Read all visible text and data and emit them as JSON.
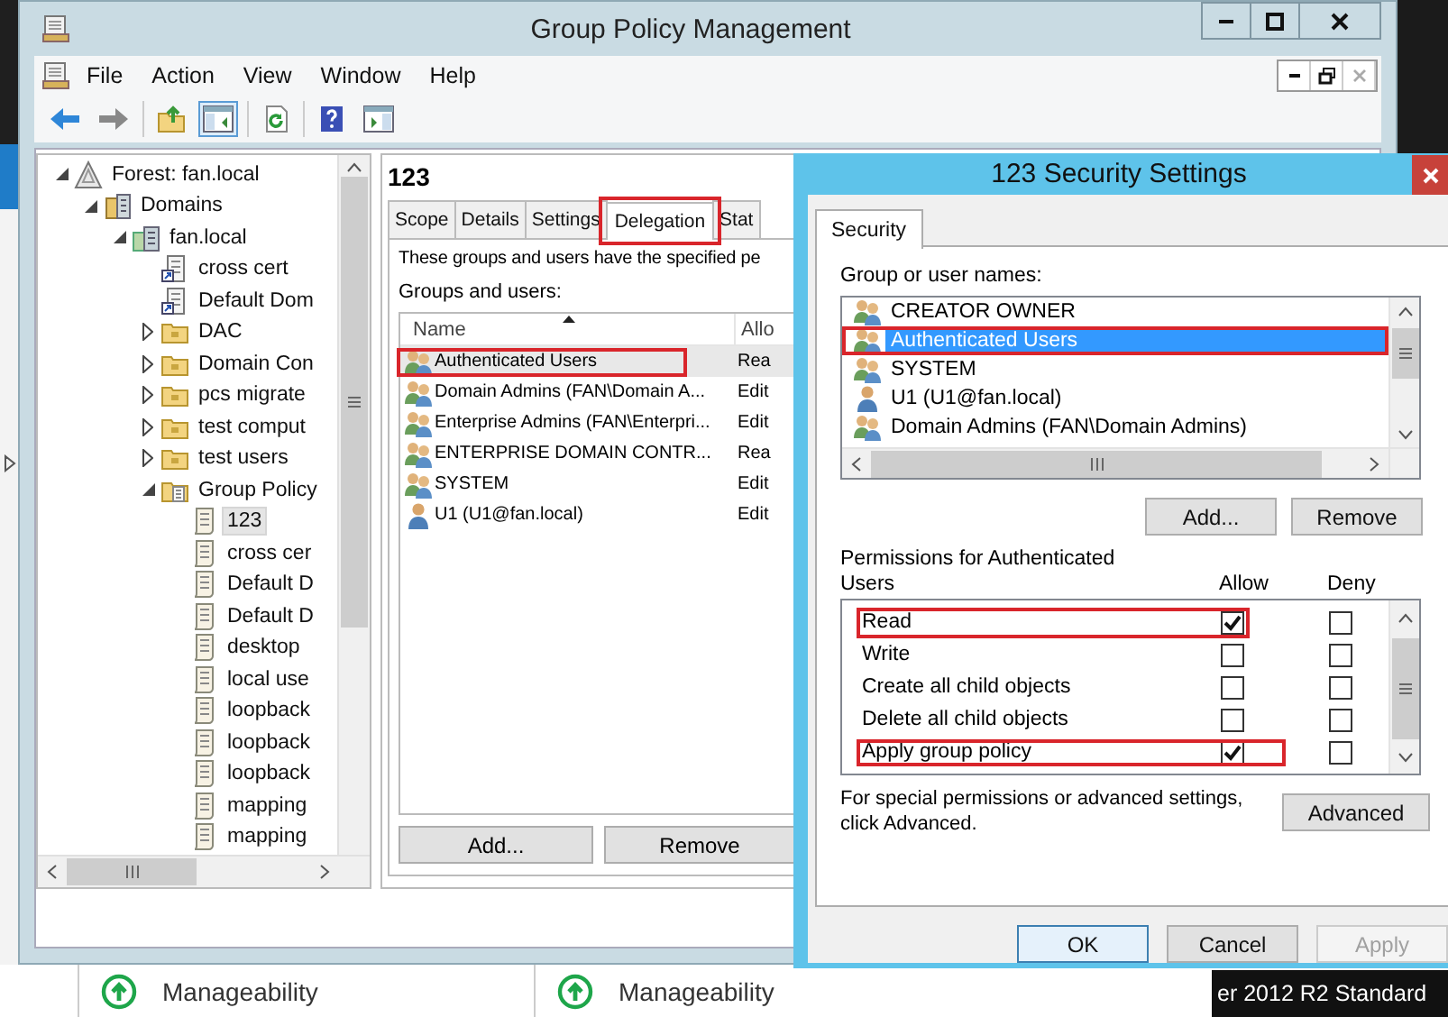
{
  "desktop": {
    "tiles": [
      {
        "label": "Manageability"
      },
      {
        "label": "Manageability"
      }
    ],
    "edition_text": "er 2012 R2 Standard"
  },
  "window": {
    "title": "Group Policy Management"
  },
  "menu": [
    "File",
    "Action",
    "View",
    "Window",
    "Help"
  ],
  "tree": [
    {
      "label": "Forest: fan.local",
      "kind": "forest",
      "expanded": true,
      "selected": false,
      "children": [
        {
          "label": "Domains",
          "kind": "domains",
          "expanded": true,
          "selected": false,
          "children": [
            {
              "label": "fan.local",
              "kind": "domain",
              "expanded": true,
              "selected": false,
              "children": [
                {
                  "label": "cross cert",
                  "kind": "link",
                  "selected": false
                },
                {
                  "label": "Default Dom",
                  "kind": "link",
                  "selected": false
                },
                {
                  "label": "DAC",
                  "kind": "ou",
                  "expanded": false,
                  "selected": false
                },
                {
                  "label": "Domain Con",
                  "kind": "ou",
                  "expanded": false,
                  "selected": false
                },
                {
                  "label": "pcs migrate",
                  "kind": "ou",
                  "expanded": false,
                  "selected": false
                },
                {
                  "label": "test comput",
                  "kind": "ou",
                  "expanded": false,
                  "selected": false
                },
                {
                  "label": "test users",
                  "kind": "ou",
                  "expanded": false,
                  "selected": false
                },
                {
                  "label": "Group Policy",
                  "kind": "container",
                  "expanded": true,
                  "selected": false,
                  "children": [
                    {
                      "label": "123",
                      "kind": "gpo",
                      "selected": true
                    },
                    {
                      "label": "cross cer",
                      "kind": "gpo",
                      "selected": false
                    },
                    {
                      "label": "Default D",
                      "kind": "gpo",
                      "selected": false
                    },
                    {
                      "label": "Default D",
                      "kind": "gpo",
                      "selected": false
                    },
                    {
                      "label": "desktop",
                      "kind": "gpo",
                      "selected": false
                    },
                    {
                      "label": "local use",
                      "kind": "gpo",
                      "selected": false
                    },
                    {
                      "label": "loopback",
                      "kind": "gpo",
                      "selected": false
                    },
                    {
                      "label": "loopback",
                      "kind": "gpo",
                      "selected": false
                    },
                    {
                      "label": "loopback",
                      "kind": "gpo",
                      "selected": false
                    },
                    {
                      "label": "mapping",
                      "kind": "gpo",
                      "selected": false
                    },
                    {
                      "label": "mapping",
                      "kind": "gpo",
                      "selected": false
                    }
                  ]
                }
              ]
            }
          ]
        }
      ]
    }
  ],
  "details": {
    "title": "123",
    "tabs": [
      {
        "label": "Scope",
        "selected": false
      },
      {
        "label": "Details",
        "selected": false
      },
      {
        "label": "Settings",
        "selected": false
      },
      {
        "label": "Delegation",
        "selected": true
      },
      {
        "label": "Stat",
        "selected": false
      }
    ],
    "description": "These groups and users have the specified pe",
    "list_label": "Groups and users:",
    "columns": [
      "Name",
      "Allo"
    ],
    "rows": [
      {
        "name": "Authenticated Users",
        "kind": "group",
        "allowed": "Rea",
        "selected": true
      },
      {
        "name": "Domain Admins (FAN\\Domain A...",
        "kind": "group",
        "allowed": "Edit",
        "selected": false
      },
      {
        "name": "Enterprise Admins (FAN\\Enterpri...",
        "kind": "group",
        "allowed": "Edit",
        "selected": false
      },
      {
        "name": "ENTERPRISE DOMAIN CONTR...",
        "kind": "group",
        "allowed": "Rea",
        "selected": false
      },
      {
        "name": "SYSTEM",
        "kind": "group",
        "allowed": "Edit",
        "selected": false
      },
      {
        "name": "U1 (U1@fan.local)",
        "kind": "user",
        "allowed": "Edit",
        "selected": false
      }
    ],
    "buttons": [
      "Add...",
      "Remove"
    ]
  },
  "dialog": {
    "title": "123 Security Settings",
    "tabs": [
      {
        "label": "Security",
        "selected": true
      }
    ],
    "names_label": "Group or user names:",
    "principals": [
      {
        "name": "CREATOR OWNER",
        "kind": "group",
        "selected": false
      },
      {
        "name": "Authenticated Users",
        "kind": "group",
        "selected": true
      },
      {
        "name": "SYSTEM",
        "kind": "group",
        "selected": false
      },
      {
        "name": "U1 (U1@fan.local)",
        "kind": "user",
        "selected": false
      },
      {
        "name": "Domain Admins (FAN\\Domain Admins)",
        "kind": "group",
        "selected": false
      }
    ],
    "buttons": [
      "Add...",
      "Remove"
    ],
    "permissions_label": "Permissions for Authenticated Users",
    "allow_label": "Allow",
    "deny_label": "Deny",
    "permissions": [
      {
        "name": "Read",
        "allow": true,
        "deny": false
      },
      {
        "name": "Write",
        "allow": false,
        "deny": false
      },
      {
        "name": "Create all child objects",
        "allow": false,
        "deny": false
      },
      {
        "name": "Delete all child objects",
        "allow": false,
        "deny": false
      },
      {
        "name": "Apply group policy",
        "allow": true,
        "deny": false
      }
    ],
    "advanced_note": "For special permissions or advanced settings, click Advanced.",
    "advanced_button": "Advanced",
    "footer_buttons": [
      {
        "label": "OK",
        "disabled": false
      },
      {
        "label": "Cancel",
        "disabled": false
      },
      {
        "label": "Apply",
        "disabled": true
      }
    ]
  }
}
